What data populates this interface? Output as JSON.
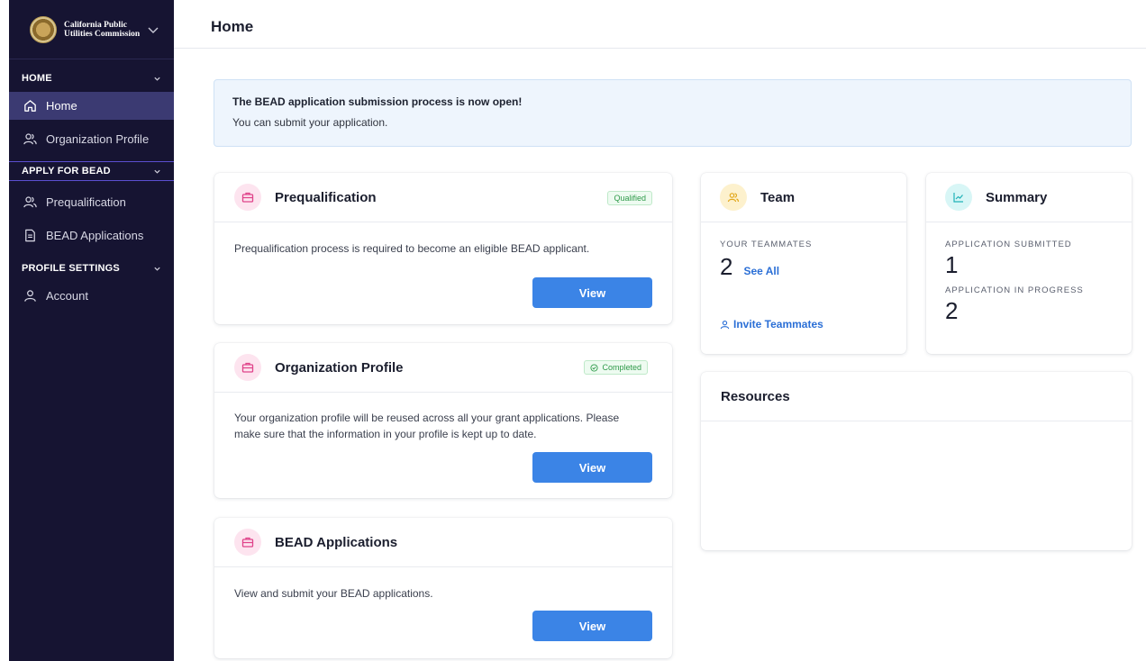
{
  "brand": {
    "name": "California Public Utilities Commission",
    "logo_icon": "seal-icon"
  },
  "sidebar": {
    "sections": [
      {
        "label": "HOME",
        "items": [
          {
            "label": "Home",
            "icon": "home-icon",
            "active": true
          },
          {
            "label": "Organization Profile",
            "icon": "users-icon"
          }
        ]
      },
      {
        "label": "APPLY FOR BEAD",
        "items": [
          {
            "label": "Prequalification",
            "icon": "users-icon"
          },
          {
            "label": "BEAD Applications",
            "icon": "document-icon"
          }
        ]
      },
      {
        "label": "PROFILE SETTINGS",
        "items": [
          {
            "label": "Account",
            "icon": "user-icon"
          }
        ]
      }
    ]
  },
  "header": {
    "title": "Home"
  },
  "alert": {
    "title": "The BEAD application submission process is now open!",
    "message": "You can submit your application."
  },
  "cards": {
    "prequalification": {
      "title": "Prequalification",
      "badge": "Qualified",
      "text": "Prequalification process is required to become an eligible BEAD applicant.",
      "button": "View"
    },
    "organization_profile": {
      "title": "Organization Profile",
      "badge": "Completed",
      "text": "Your organization profile will be reused across all your grant applications. Please make sure that the information in your profile is kept up to date.",
      "button": "View"
    },
    "bead_applications": {
      "title": "BEAD Applications",
      "text": "View and submit your BEAD applications.",
      "button": "View"
    }
  },
  "team": {
    "title": "Team",
    "teammates_label": "YOUR TEAMMATES",
    "teammates_count": "2",
    "see_all": "See All",
    "invite": "Invite Teammates"
  },
  "summary": {
    "title": "Summary",
    "submitted_label": "APPLICATION SUBMITTED",
    "submitted_count": "1",
    "in_progress_label": "APPLICATION IN PROGRESS",
    "in_progress_count": "2"
  },
  "resources": {
    "title": "Resources"
  },
  "colors": {
    "sidebar_bg": "#161432",
    "active_bg": "#3b3a72",
    "primary": "#3b84e6",
    "success": "#2f9a4a",
    "pink": "#e0438a"
  }
}
